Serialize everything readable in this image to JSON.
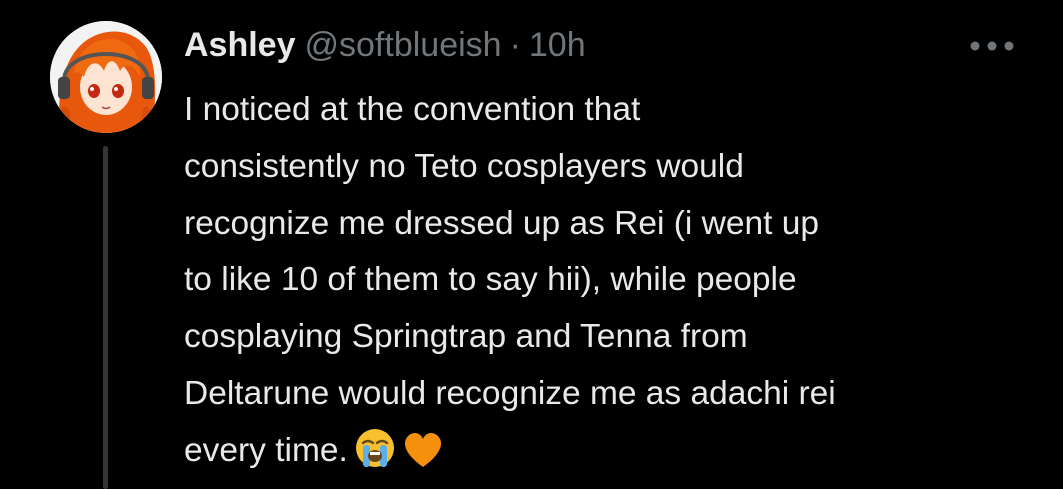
{
  "tweet": {
    "display_name": "Ashley",
    "handle": "@softblueish",
    "separator": "·",
    "time": "10h",
    "more_label": "•••",
    "body_lines": [
      "I noticed at the convention that",
      "consistently no Teto cosplayers would",
      "recognize me dressed up as Rei (i went up",
      "to like 10 of them to say hii), while people",
      "cosplaying Springtrap and Tenna from",
      "Deltarune would recognize me as adachi rei",
      "every time."
    ],
    "emojis": [
      "loudly-crying-face",
      "orange-heart"
    ]
  },
  "colors": {
    "background": "#000000",
    "primary_text": "#e7e9ea",
    "secondary_text": "#71767b",
    "thread_line": "#333639",
    "emoji_yellow": "#f7c02c",
    "heart_orange": "#f4900c"
  }
}
